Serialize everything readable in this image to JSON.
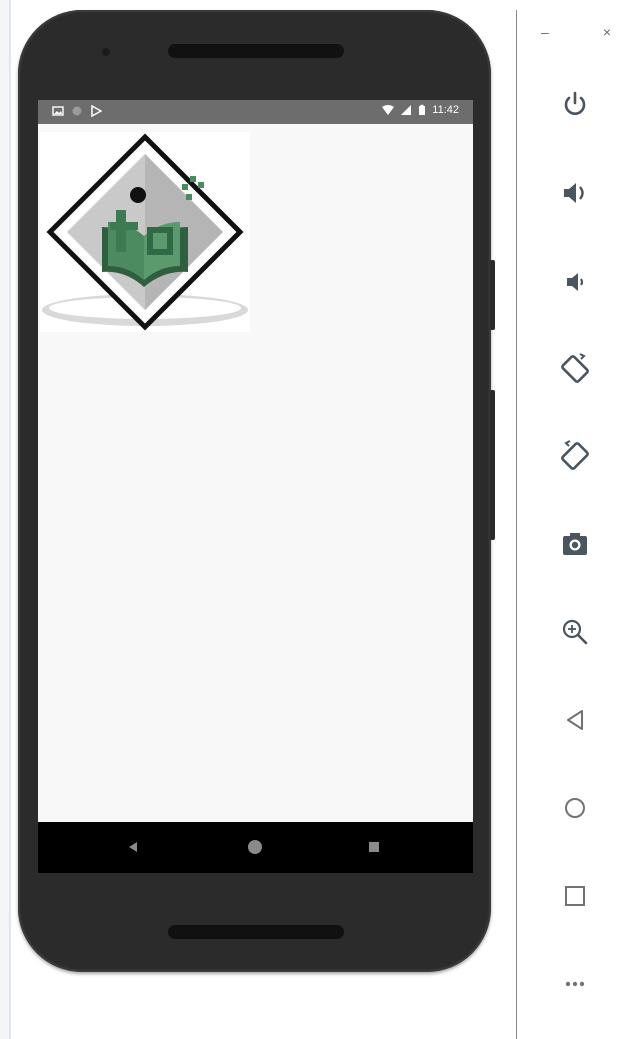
{
  "emulator": {
    "status_bar": {
      "time": "11:42",
      "left_icons": [
        "image-icon",
        "circle-icon",
        "play-store-icon"
      ],
      "right_icons": [
        "wifi-icon",
        "signal-icon",
        "battery-icon"
      ]
    },
    "app_logo": "tutorialspoint-logo",
    "nav_bar": [
      "back-button",
      "home-button",
      "overview-button"
    ]
  },
  "control_panel": {
    "window_controls": {
      "minimize": "–",
      "close": "×"
    },
    "controls": [
      "power-icon",
      "volume-up-icon",
      "volume-down-icon",
      "rotate-left-icon",
      "rotate-right-icon",
      "camera-icon",
      "zoom-icon",
      "back-icon",
      "home-icon",
      "overview-icon",
      "more-icon"
    ],
    "accent_color": "#4a5560",
    "icon_color_light": "#6f7478"
  }
}
